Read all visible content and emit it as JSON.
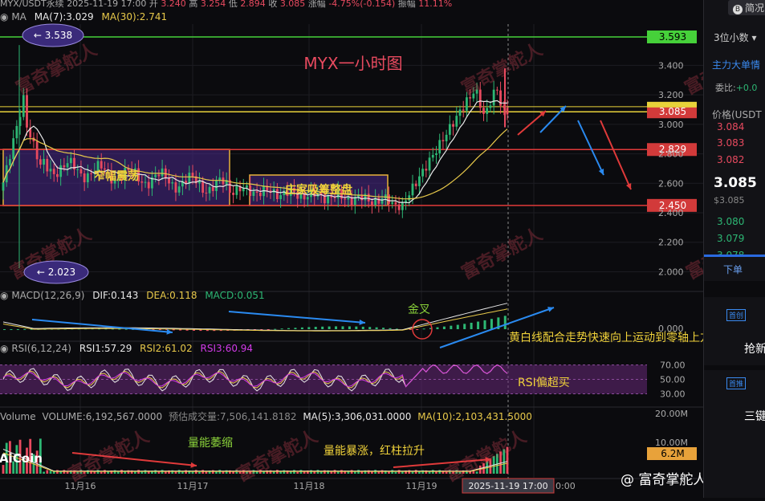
{
  "header": {
    "pair": "MYX/USDT永续",
    "time": "2025-11-19 17:00",
    "open_label": "开",
    "open": "3.240",
    "high_label": "高",
    "high": "3.254",
    "low_label": "低",
    "low": "2.894",
    "close_label": "收",
    "close": "3.085",
    "change_label": "涨幅",
    "change": "-4.75%(-0.154)",
    "amp_label": "振幅",
    "amp": "11.11%"
  },
  "ma_legend": {
    "ma": "MA",
    "ma7": "MA(7):3.029",
    "ma30": "MA(30):2.741"
  },
  "chart_title": "MYX一小时图",
  "watermark": "富奇掌舵人",
  "brand": "AiCoin",
  "footer_credit": "@ 富奇掌舵人",
  "colors": {
    "bg": "#0b0b0e",
    "up": "#2db774",
    "down": "#e84a5f",
    "ma7": "#e8e8e8",
    "ma30": "#e8c94a",
    "green_line": "#46d13a",
    "yellow_line": "#e8d23a",
    "red_line": "#e03a3a",
    "box_fill": "#4a2a8a",
    "box_border": "#e8b23a",
    "arrow_blue": "#2a8af0",
    "arrow_red": "#e03a3a",
    "annot_green": "#8ad13a",
    "annot_yellow": "#f0d23a",
    "rsi_band": "#6a2a7a"
  },
  "annotations": {
    "box1": "窄幅震荡",
    "box2": "庄家吸筹整盘",
    "golden_cross": "金叉",
    "macd_note": "黄白线配合走势快速向上运动到零轴上方",
    "rsi_note": "RSI偏超买",
    "vol_shrink": "量能萎缩",
    "vol_surge": "量能暴涨，红柱拉升"
  },
  "markers": {
    "high_marker": "← 3.538",
    "low_marker": "← 2.023"
  },
  "price_tags": {
    "green": "3.593",
    "yellow": "3.085",
    "red1": "2.829",
    "red2": "2.450"
  },
  "macd_legend": {
    "label": "MACD(12,26,9)",
    "dif": "DIF:0.143",
    "dea": "DEA:0.118",
    "macd": "MACD:0.051"
  },
  "rsi_legend": {
    "label": "RSI(6,12,24)",
    "rsi1": "RSI1:57.29",
    "rsi2": "RSI2:61.02",
    "rsi3": "RSI3:60.94"
  },
  "vol_legend": {
    "label": "Volume",
    "volume": "VOLUME:6,192,567.0000",
    "est": "预估成交量:7,506,141.8182",
    "ma5": "MA(5):3,306,031.0000",
    "ma10": "MA(10):2,103,431.5000"
  },
  "vol_tag": "6.2M",
  "x_axis": {
    "ticks": [
      "11月16",
      "11月17",
      "11月18",
      "11月19"
    ],
    "cursor": "2025-11-19 17:00",
    "cut": "0:00"
  },
  "sidebar": {
    "simplified": "简况",
    "decimals": "3位小数",
    "big_orders": "主力大单情",
    "ratio_label": "委比:",
    "ratio": "+0.0",
    "price_label": "价格(USDT",
    "asks": [
      "3.084",
      "3.083",
      "3.082"
    ],
    "last": "3.085",
    "last_usd": "$3.085",
    "bids": [
      "3.080",
      "3.079",
      "3.078"
    ],
    "lower": "下单",
    "rec1": "首创",
    "rec1_text": "抢新",
    "rec2": "首推",
    "rec2_text": "三键"
  },
  "chart_data": [
    {
      "type": "candlestick",
      "title": "MYX一小时图",
      "x_ticks": [
        "11月16",
        "11月17",
        "11月18",
        "11月19"
      ],
      "ylim": [
        1.85,
        3.68
      ],
      "y_ticks": [
        "3.400",
        "3.200",
        "3.000",
        "2.800",
        "2.600",
        "2.400",
        "2.200",
        "2.000"
      ],
      "series": [
        {
          "name": "MA(7)",
          "last": 3.029
        },
        {
          "name": "MA(30)",
          "last": 2.741
        }
      ],
      "levels": [
        3.593,
        3.085,
        2.829,
        2.45
      ],
      "range_boxes": [
        {
          "label": "窄幅震荡",
          "x": [
            "11月15",
            "11月16"
          ],
          "y": [
            2.45,
            2.95
          ]
        },
        {
          "label": "庄家吸筹整盘",
          "x": [
            "11月17",
            "11月18"
          ],
          "y": [
            2.45,
            2.66
          ]
        }
      ],
      "last_candle": {
        "time": "2025-11-19 17:00",
        "open": 3.24,
        "high": 3.254,
        "low": 2.894,
        "close": 3.085
      }
    },
    {
      "type": "line",
      "title": "MACD(12,26,9)",
      "series": [
        {
          "name": "DIF",
          "last": 0.143
        },
        {
          "name": "DEA",
          "last": 0.118
        },
        {
          "name": "MACD",
          "last": 0.051
        }
      ],
      "y_ticks": [
        "0.000"
      ]
    },
    {
      "type": "line",
      "title": "RSI(6,12,24)",
      "series": [
        {
          "name": "RSI1",
          "last": 57.29
        },
        {
          "name": "RSI2",
          "last": 61.02
        },
        {
          "name": "RSI3",
          "last": 60.94
        }
      ],
      "y_ticks": [
        "70.00",
        "50.00",
        "30.00"
      ]
    },
    {
      "type": "bar",
      "title": "Volume",
      "series": [
        {
          "name": "VOLUME",
          "last": 6192567
        },
        {
          "name": "MA(5)",
          "last": 3306031
        },
        {
          "name": "MA(10)",
          "last": 2103431.5
        }
      ],
      "y_ticks": [
        "20.00M",
        "10.00M"
      ]
    }
  ]
}
